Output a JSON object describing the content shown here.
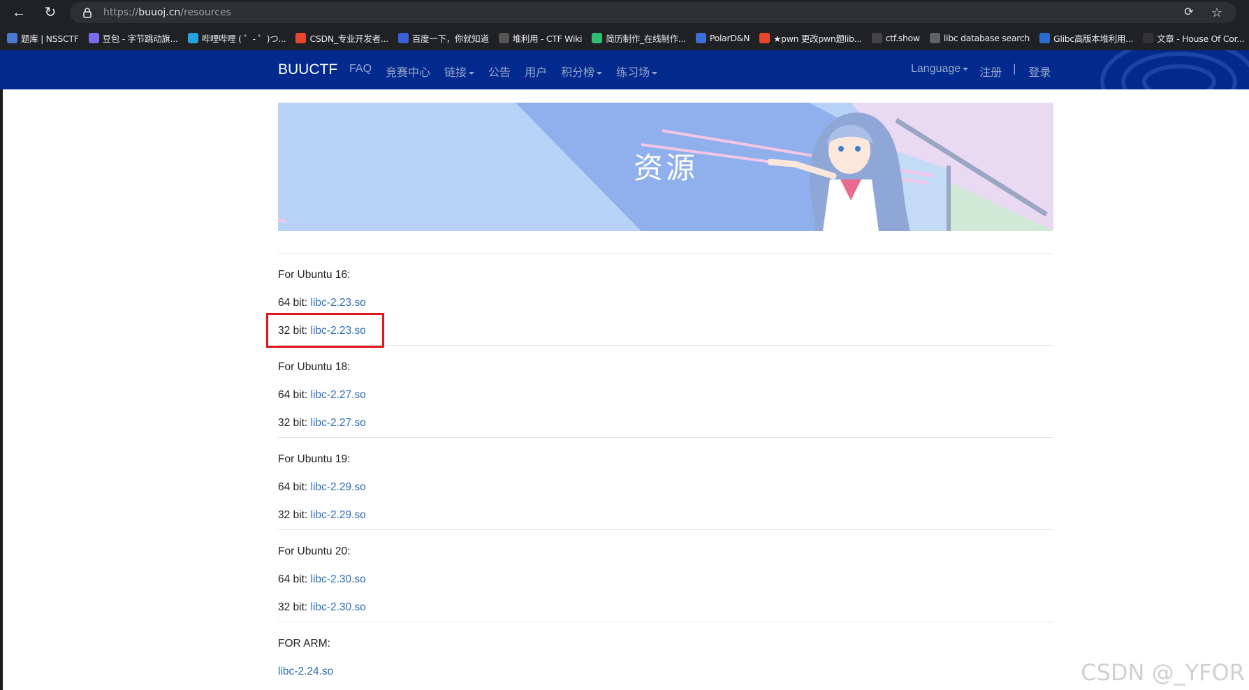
{
  "browser": {
    "url_scheme": "https://",
    "url_host": "buuoj.cn",
    "url_path": "/resources",
    "bookmarks": [
      {
        "label": "题库 | NSSCTF",
        "icon": "nssctf-icon",
        "color": "#4a7bd0"
      },
      {
        "label": "豆包 - 字节跳动旗...",
        "icon": "doubao-icon",
        "color": "#7a6cf0"
      },
      {
        "label": "哔哩哔哩 ( ゜- ゜)つ...",
        "icon": "bilibili-icon",
        "color": "#23a3e0"
      },
      {
        "label": "CSDN_专业开发者...",
        "icon": "csdn-icon",
        "color": "#e8462c"
      },
      {
        "label": "百度一下，你就知道",
        "icon": "baidu-icon",
        "color": "#3a5fd8"
      },
      {
        "label": "堆利用 - CTF Wiki",
        "icon": "ctfwiki-icon",
        "color": "#555555"
      },
      {
        "label": "简历制作_在线制作...",
        "icon": "resume-icon",
        "color": "#2fbf71"
      },
      {
        "label": "PolarD&N",
        "icon": "polar-icon",
        "color": "#3b6fd6"
      },
      {
        "label": "★pwn 更改pwn题lib...",
        "icon": "csdn-icon",
        "color": "#e8462c"
      },
      {
        "label": "ctf.show",
        "icon": "ctfshow-icon",
        "color": "#444444"
      },
      {
        "label": "libc database search",
        "icon": "globe-icon",
        "color": "#5f6368"
      },
      {
        "label": "Glibc高版本堆利用...",
        "icon": "glibc-icon",
        "color": "#2b6cd0"
      },
      {
        "label": "文章 - House Of Cor...",
        "icon": "article-icon",
        "color": "#333333"
      }
    ]
  },
  "site": {
    "brand": "BUUCTF",
    "nav": [
      "FAQ",
      "竞赛中心",
      "链接",
      "公告",
      "用户",
      "积分榜",
      "练习场"
    ],
    "nav_dropdown": [
      false,
      false,
      true,
      false,
      false,
      true,
      true
    ],
    "language": "Language",
    "register": "注册",
    "separator": "|",
    "login": "登录"
  },
  "banner": {
    "title": "资源"
  },
  "resources": [
    {
      "heading": "For Ubuntu 16:",
      "items": [
        {
          "prefix": "64 bit: ",
          "link": "libc-2.23.so"
        },
        {
          "prefix": "32 bit: ",
          "link": "libc-2.23.so"
        }
      ]
    },
    {
      "heading": "For Ubuntu 18:",
      "items": [
        {
          "prefix": "64 bit: ",
          "link": "libc-2.27.so"
        },
        {
          "prefix": "32 bit: ",
          "link": "libc-2.27.so"
        }
      ]
    },
    {
      "heading": "For Ubuntu 19:",
      "items": [
        {
          "prefix": "64 bit: ",
          "link": "libc-2.29.so"
        },
        {
          "prefix": "32 bit: ",
          "link": "libc-2.29.so"
        }
      ]
    },
    {
      "heading": "For Ubuntu 20:",
      "items": [
        {
          "prefix": "64 bit: ",
          "link": "libc-2.30.so"
        },
        {
          "prefix": "32 bit: ",
          "link": "libc-2.30.so"
        }
      ]
    },
    {
      "heading": "FOR ARM:",
      "items": [
        {
          "prefix": "",
          "link": "libc-2.24.so"
        }
      ]
    }
  ],
  "watermark": "CSDN @_YFOR",
  "colors": {
    "navbar": "#022a8e",
    "link": "#2a6fb7",
    "highlight": "#e5151d"
  }
}
